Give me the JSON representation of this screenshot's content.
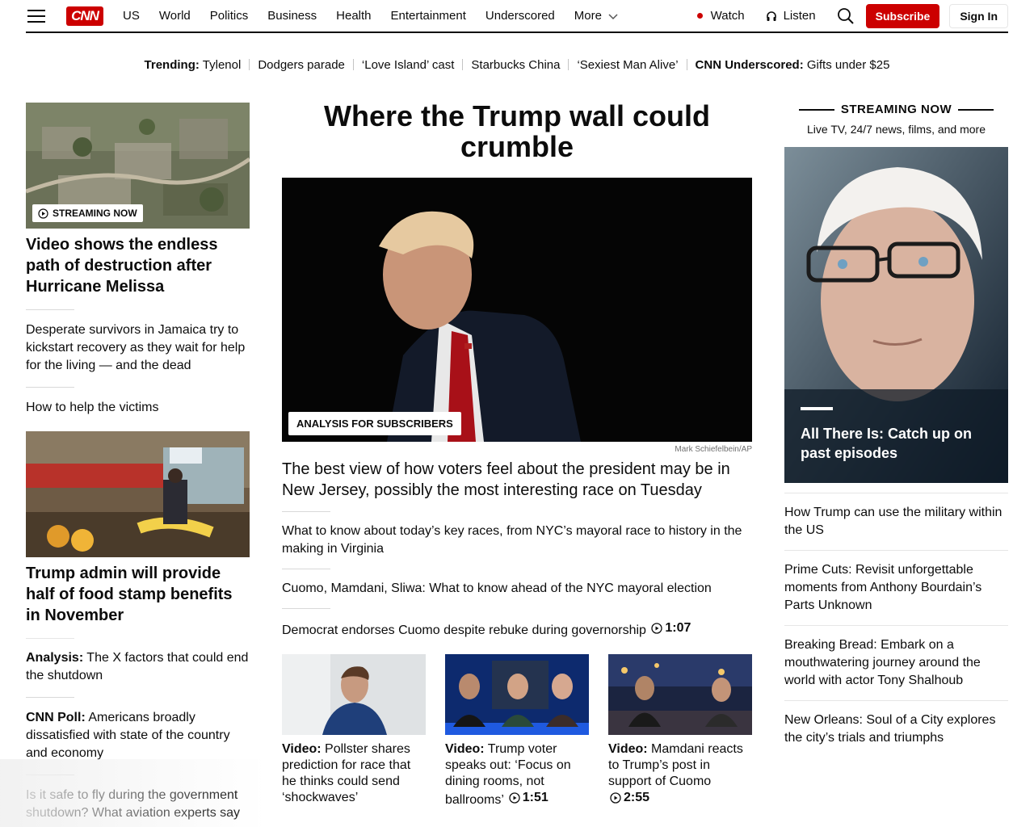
{
  "header": {
    "logo": "CNN",
    "nav": [
      "US",
      "World",
      "Politics",
      "Business",
      "Health",
      "Entertainment",
      "Underscored",
      "More"
    ],
    "watch": "Watch",
    "listen": "Listen",
    "subscribe": "Subscribe",
    "signin": "Sign In"
  },
  "trending": {
    "label": "Trending:",
    "items": [
      "Tylenol",
      "Dodgers parade",
      "‘Love Island’ cast",
      "Starbucks China",
      "‘Sexiest Man Alive’"
    ],
    "underscored_label": "CNN Underscored:",
    "underscored_text": "Gifts under $25"
  },
  "left": {
    "badge": "STREAMING NOW",
    "headline1": "Video shows the endless path of destruction after Hurricane Melissa",
    "story1": "Desperate survivors in Jamaica try to kickstart recovery as they wait for help for the living — and the dead",
    "story2": "How to help the victims",
    "headline2": "Trump admin will provide half of food stamp benefits in November",
    "story3_label": "Analysis:",
    "story3": " The X factors that could end the shutdown",
    "story4_label": "CNN Poll:",
    "story4": " Americans broadly dissatisfied with state of the country and economy",
    "story5": "Is it safe to fly during the government shutdown? What aviation experts say"
  },
  "main": {
    "headline": "Where the Trump wall could crumble",
    "badge": "ANALYSIS FOR SUBSCRIBERS",
    "credit": "Mark Schiefelbein/AP",
    "subhead": "The best view of how voters feel about the president may be in New Jersey, possibly the most interesting race on Tuesday",
    "story1": "What to know about today’s key races, from NYC’s mayoral race to history in the making in Virginia",
    "story2": "Cuomo, Mamdani, Sliwa: What to know ahead of the NYC mayoral election",
    "story3": "Democrat endorses Cuomo despite rebuke during governorship",
    "story3_duration": "1:07",
    "thumbs": [
      {
        "label": "Video:",
        "text": " Pollster shares prediction for race that he thinks could send ‘shockwaves’"
      },
      {
        "label": "Video:",
        "text": " Trump voter speaks out: ‘Focus on dining rooms, not ballrooms’ ",
        "duration": "1:51"
      },
      {
        "label": "Video:",
        "text": " Mamdani reacts to Trump’s post in support of Cuomo ",
        "duration": "2:55"
      }
    ]
  },
  "right": {
    "streaming_head": "STREAMING NOW",
    "streaming_sub": "Live TV, 24/7 news, films, and more",
    "promo_text": "All There Is: Catch up on past episodes",
    "stories": [
      "How Trump can use the military within the US",
      "Prime Cuts: Revisit unforgettable moments from Anthony Bourdain’s Parts Unknown",
      "Breaking Bread: Embark on a mouthwatering journey around the world with actor Tony Shalhoub",
      "New Orleans: Soul of a City explores the city’s trials and triumphs"
    ]
  },
  "colors": {
    "brand_red": "#cc0000",
    "text": "#0c0c0c"
  }
}
